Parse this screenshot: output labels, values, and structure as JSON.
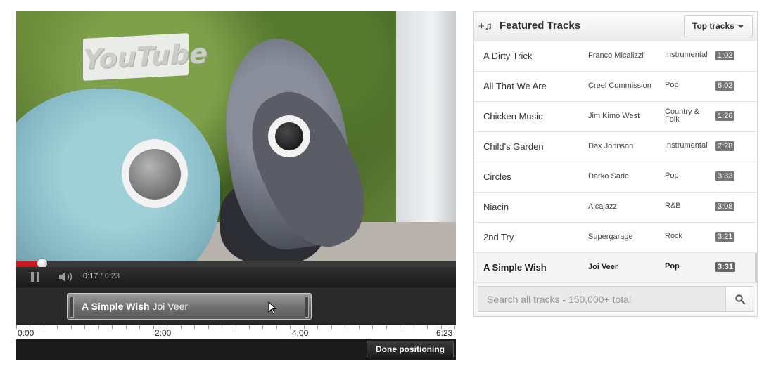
{
  "player": {
    "current_time": "0:17",
    "duration": "6:23",
    "time_separator": " / ",
    "progress_fraction": 0.059,
    "video_sign_text": "YouTube"
  },
  "positioning": {
    "track_title": "A Simple Wish",
    "track_artist": "Joi Veer",
    "timeline_labels": [
      "0:00",
      "2:00",
      "4:00",
      "6:23"
    ],
    "done_label": "Done positioning"
  },
  "panel": {
    "title": "Featured Tracks",
    "add_icon": "add-music-icon",
    "dropdown_label": "Top tracks",
    "tracks": [
      {
        "title": "A Dirty Trick",
        "artist": "Franco Micalizzi",
        "genre": "Instrumental",
        "duration": "1:02"
      },
      {
        "title": "All That We Are",
        "artist": "Creel Commission",
        "genre": "Pop",
        "duration": "6:02"
      },
      {
        "title": "Chicken Music",
        "artist": "Jim Kimo West",
        "genre": "Country & Folk",
        "duration": "1:26"
      },
      {
        "title": "Child's Garden",
        "artist": "Dax Johnson",
        "genre": "Instrumental",
        "duration": "2:28"
      },
      {
        "title": "Circles",
        "artist": "Darko Saric",
        "genre": "Pop",
        "duration": "3:33"
      },
      {
        "title": "Niacin",
        "artist": "Alcajazz",
        "genre": "R&B",
        "duration": "3:08"
      },
      {
        "title": "2nd Try",
        "artist": "Supergarage",
        "genre": "Rock",
        "duration": "3:21"
      },
      {
        "title": "A Simple Wish",
        "artist": "Joi Veer",
        "genre": "Pop",
        "duration": "3:31"
      }
    ],
    "search_placeholder": "Search all tracks - 150,000+ total",
    "search_icon": "search-icon"
  },
  "colors": {
    "progress_red": "#cc181e",
    "duration_badge": "#777777"
  }
}
